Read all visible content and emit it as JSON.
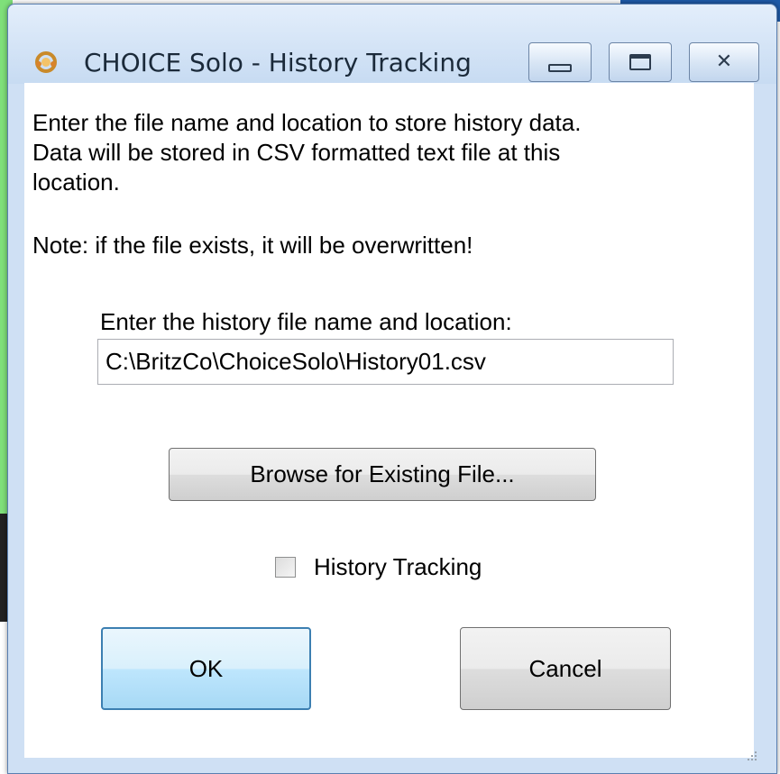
{
  "window": {
    "title": "CHOICE Solo - History Tracking",
    "icon": "choice-app-icon",
    "caption_buttons": [
      "minimize-icon",
      "maximize-icon",
      "close-icon"
    ],
    "close_glyph": "✕"
  },
  "intro": {
    "line1": "Enter the file name and location to store history data.",
    "line2": "Data will be stored in CSV formatted text file at this",
    "line3": "location."
  },
  "note": "Note: if the file exists, it will be overwritten!",
  "history_file": {
    "label": "Enter the history file name and location:",
    "value": "C:\\BritzCo\\ChoiceSolo\\History01.csv"
  },
  "browse_button": "Browse for Existing File...",
  "history_tracking": {
    "label": "History Tracking",
    "checked": false
  },
  "ok_button": "OK",
  "cancel_button": "Cancel",
  "colors": {
    "titlebar": "#c7dbf2",
    "ok_border": "#3c7fb1",
    "green_backdrop": "#7fe07a",
    "blue_backdrop": "#1e5aa8"
  }
}
